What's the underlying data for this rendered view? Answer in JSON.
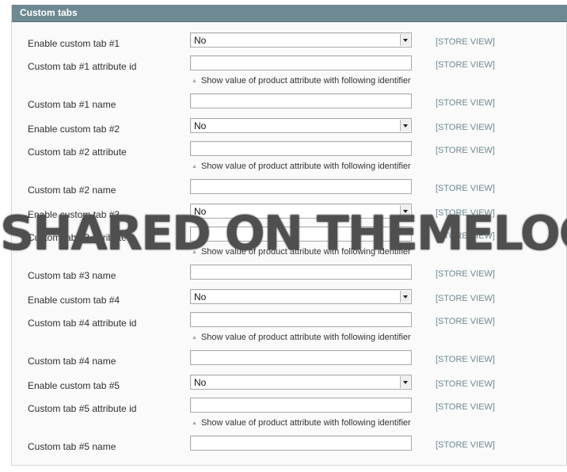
{
  "section": {
    "title": "Custom tabs"
  },
  "scope_label": "[STORE VIEW]",
  "note_text": "Show value of product attribute with following identifier",
  "rows": [
    {
      "label": "Enable custom tab #1",
      "type": "select",
      "value": "No"
    },
    {
      "label": "Custom tab #1 attribute id",
      "type": "text",
      "value": "",
      "note": true
    },
    {
      "label": "Custom tab #1 name",
      "type": "text",
      "value": ""
    },
    {
      "label": "Enable custom tab #2",
      "type": "select",
      "value": "No"
    },
    {
      "label": "Custom tab #2 attribute",
      "type": "text",
      "value": "",
      "note": true
    },
    {
      "label": "Custom tab #2 name",
      "type": "text",
      "value": ""
    },
    {
      "label": "Enable custom tab #3",
      "type": "select",
      "value": "No"
    },
    {
      "label": "Custom tab #3 attribute",
      "type": "text",
      "value": "",
      "note": true
    },
    {
      "label": "Custom tab #3 name",
      "type": "text",
      "value": ""
    },
    {
      "label": "Enable custom tab #4",
      "type": "select",
      "value": "No"
    },
    {
      "label": "Custom tab #4 attribute id",
      "type": "text",
      "value": "",
      "note": true
    },
    {
      "label": "Custom tab #4 name",
      "type": "text",
      "value": ""
    },
    {
      "label": "Enable custom tab #5",
      "type": "select",
      "value": "No"
    },
    {
      "label": "Custom tab #5 attribute id",
      "type": "text",
      "value": "",
      "note": true
    },
    {
      "label": "Custom tab #5 name",
      "type": "text",
      "value": ""
    }
  ],
  "watermark": "SHARED ON THEMELOCK.COM",
  "colors": {
    "header": "#6f8992",
    "scope": "#6f8992"
  }
}
